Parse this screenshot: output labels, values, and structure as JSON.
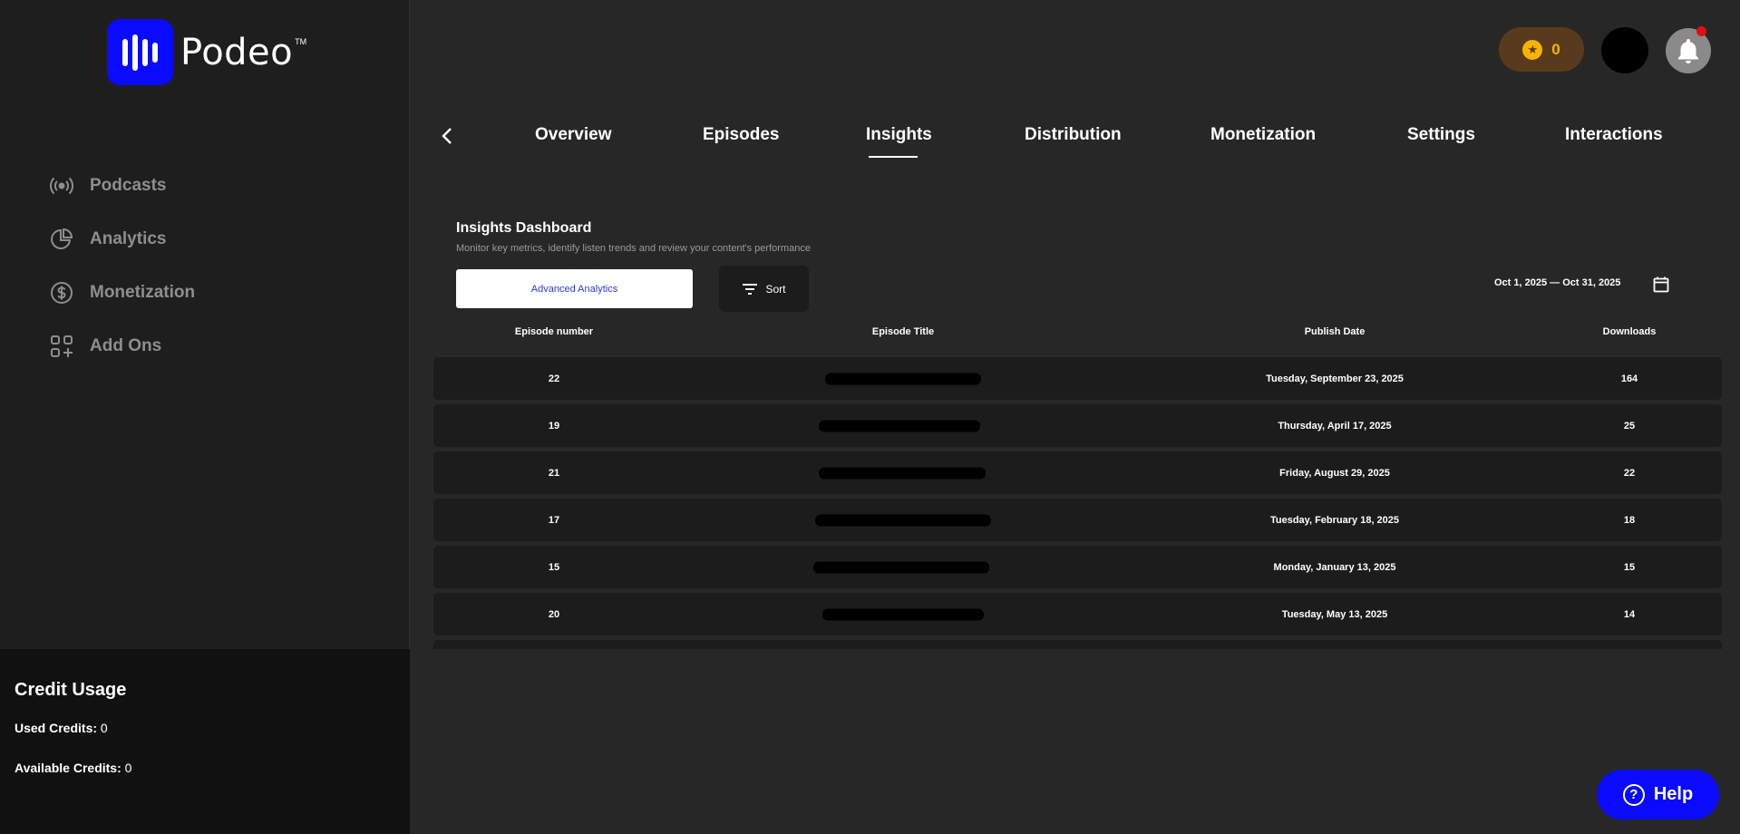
{
  "app": {
    "logo_text": "Podeo",
    "logo_tm": "TM",
    "accent_color": "#0a0aff"
  },
  "sidebar": {
    "items": [
      {
        "label": "Podcasts",
        "icon": "podcast-broadcast-icon"
      },
      {
        "label": "Analytics",
        "icon": "pie-chart-icon"
      },
      {
        "label": "Monetization",
        "icon": "dollar-circle-icon"
      },
      {
        "label": "Add Ons",
        "icon": "grid-plus-icon"
      }
    ]
  },
  "credit": {
    "title": "Credit Usage",
    "used_label": "Used Credits:",
    "used_value": "0",
    "available_label": "Available Credits:",
    "available_value": "0"
  },
  "header": {
    "coins": "0",
    "coin_icon": "star-coin-icon",
    "bell_icon": "bell-icon"
  },
  "tabs": [
    {
      "label": "Overview"
    },
    {
      "label": "Episodes"
    },
    {
      "label": "Insights",
      "active": true
    },
    {
      "label": "Distribution"
    },
    {
      "label": "Monetization"
    },
    {
      "label": "Settings"
    },
    {
      "label": "Interactions"
    }
  ],
  "dashboard": {
    "title": "Insights Dashboard",
    "subtitle": "Monitor key metrics, identify listen trends and review your content's performance",
    "advanced_button": "Advanced Analytics",
    "sort_button": "Sort",
    "date_range": "Oct 1, 2025 — Oct 31, 2025"
  },
  "table": {
    "headers": [
      "Episode number",
      "Episode Title",
      "Publish Date",
      "Downloads"
    ],
    "rows": [
      {
        "number": "22",
        "title": "",
        "date": "Tuesday, September 23, 2025",
        "downloads": "164"
      },
      {
        "number": "19",
        "title": "",
        "date": "Thursday, April 17, 2025",
        "downloads": "25"
      },
      {
        "number": "21",
        "title": "",
        "date": "Friday, August 29, 2025",
        "downloads": "22"
      },
      {
        "number": "17",
        "title": "",
        "date": "Tuesday, February 18, 2025",
        "downloads": "18"
      },
      {
        "number": "15",
        "title": "",
        "date": "Monday, January 13, 2025",
        "downloads": "15"
      },
      {
        "number": "20",
        "title": "",
        "date": "Tuesday, May 13, 2025",
        "downloads": "14"
      }
    ]
  },
  "help": {
    "label": "Help"
  }
}
